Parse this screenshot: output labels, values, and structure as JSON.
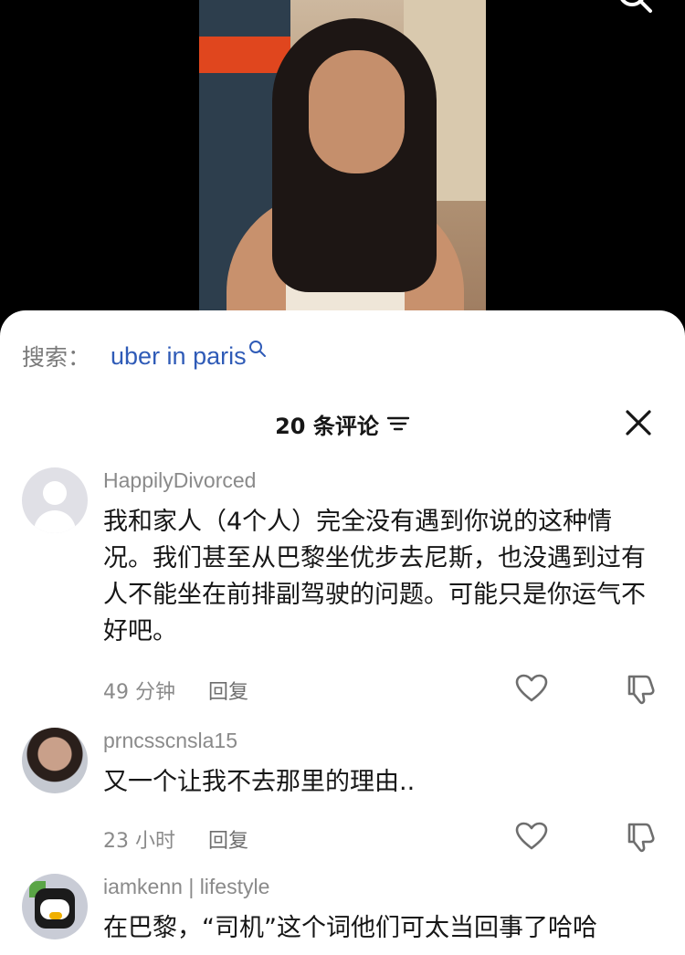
{
  "search": {
    "label": "搜索：",
    "query": "uber in paris"
  },
  "comments_header": {
    "count_text": "20 条评论"
  },
  "comments": [
    {
      "username": "HappilyDivorced",
      "text": "我和家人（4个人）完全没有遇到你说的这种情况。我们甚至从巴黎坐优步去尼斯，也没遇到过有人不能坐在前排副驾驶的问题。可能只是你运气不好吧。",
      "time": "49 分钟",
      "reply": "回复"
    },
    {
      "username": "prncsscnsla15",
      "text": "又一个让我不去那里的理由..",
      "time": "23 小时",
      "reply": "回复"
    },
    {
      "username": "iamkenn | lifestyle",
      "text": "在巴黎，“司机”这个词他们可太当回事了哈哈"
    }
  ]
}
